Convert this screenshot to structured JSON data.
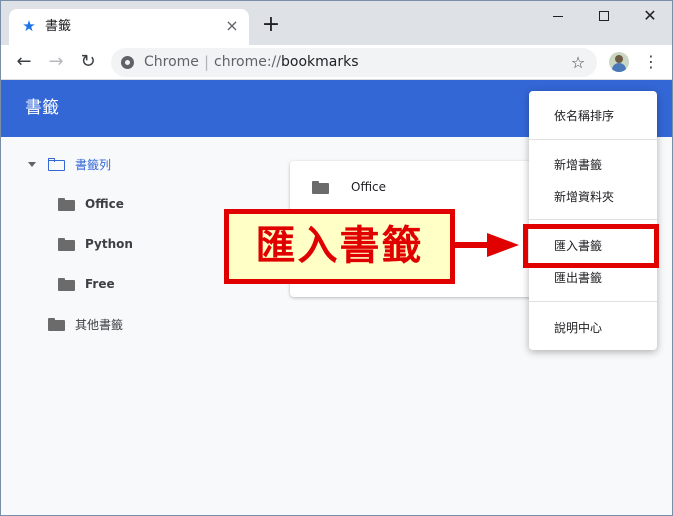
{
  "tab": {
    "title": "書籤",
    "favicon_icon": "star-icon"
  },
  "toolbar": {
    "omnibox_app": "Chrome",
    "omnibox_separator": "|",
    "omnibox_scheme": "chrome://",
    "omnibox_host": "bookmarks"
  },
  "header": {
    "title": "書籤"
  },
  "sidebar": {
    "root_label": "書籤列",
    "children": [
      "Office",
      "Python",
      "Free"
    ],
    "other_label": "其他書籤"
  },
  "main": {
    "items": [
      "Office"
    ]
  },
  "menu": {
    "items": [
      "依名稱排序",
      "新增書籤",
      "新增資料夾",
      "匯入書籤",
      "匯出書籤",
      "說明中心"
    ]
  },
  "annotation": {
    "text": "匯入書籤"
  },
  "colors": {
    "header": "#3367d6",
    "annotation": "#e00000",
    "callout_fill": "#ffffc6"
  }
}
